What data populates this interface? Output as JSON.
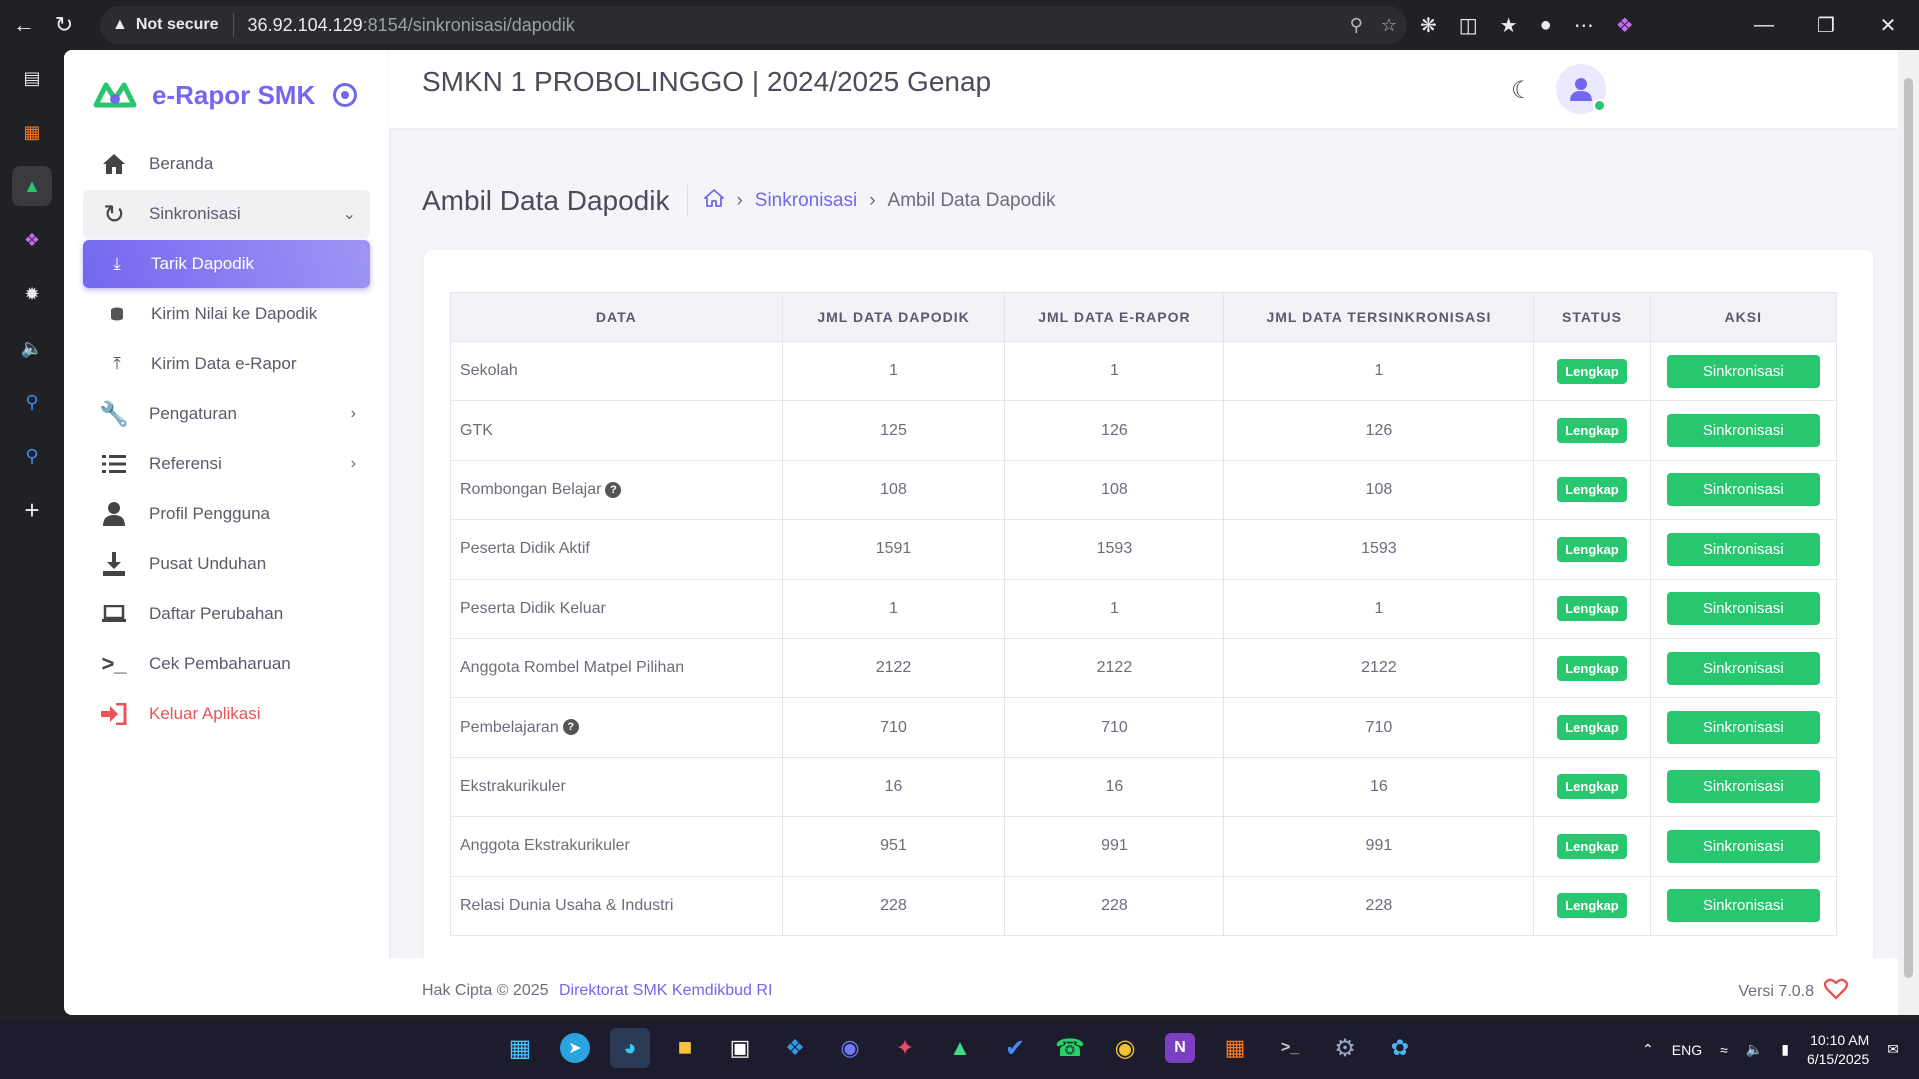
{
  "browser": {
    "security_label": "Not secure",
    "url_host": "36.92.104.129",
    "url_path": ":8154/sinkronisasi/dapodik"
  },
  "app": {
    "brand": "e-Rapor SMK",
    "school_title": "SMKN 1 PROBOLINGGO | 2024/2025 Genap"
  },
  "sidebar": {
    "items": [
      {
        "label": "Beranda",
        "icon": "home-icon"
      },
      {
        "label": "Sinkronisasi",
        "icon": "sync-icon"
      },
      {
        "label": "Pengaturan",
        "icon": "wrench-icon"
      },
      {
        "label": "Referensi",
        "icon": "list-icon"
      },
      {
        "label": "Profil Pengguna",
        "icon": "user-icon"
      },
      {
        "label": "Pusat Unduhan",
        "icon": "download-icon"
      },
      {
        "label": "Daftar Perubahan",
        "icon": "laptop-code-icon"
      },
      {
        "label": "Cek Pembaharuan",
        "icon": "terminal-icon"
      },
      {
        "label": "Keluar Aplikasi",
        "icon": "logout-icon"
      }
    ],
    "sub_items": [
      {
        "label": "Tarik Dapodik",
        "icon": "download-icon"
      },
      {
        "label": "Kirim Nilai ke Dapodik",
        "icon": "database-icon"
      },
      {
        "label": "Kirim Data e-Rapor",
        "icon": "upload-icon"
      }
    ]
  },
  "content": {
    "page_title": "Ambil Data Dapodik",
    "breadcrumb": {
      "parent": "Sinkronisasi",
      "current": "Ambil Data Dapodik"
    },
    "table": {
      "headers": [
        "DATA",
        "JML DATA DAPODIK",
        "JML DATA E-RAPOR",
        "JML DATA TERSINKRONISASI",
        "STATUS",
        "AKSI"
      ],
      "rows": [
        {
          "name": "Sekolah",
          "dapodik": "1",
          "erapor": "1",
          "sync": "1",
          "status": "Lengkap",
          "action": "Sinkronisasi",
          "help": false
        },
        {
          "name": "GTK",
          "dapodik": "125",
          "erapor": "126",
          "sync": "126",
          "status": "Lengkap",
          "action": "Sinkronisasi",
          "help": false
        },
        {
          "name": "Rombongan Belajar",
          "dapodik": "108",
          "erapor": "108",
          "sync": "108",
          "status": "Lengkap",
          "action": "Sinkronisasi",
          "help": true
        },
        {
          "name": "Peserta Didik Aktif",
          "dapodik": "1591",
          "erapor": "1593",
          "sync": "1593",
          "status": "Lengkap",
          "action": "Sinkronisasi",
          "help": false
        },
        {
          "name": "Peserta Didik Keluar",
          "dapodik": "1",
          "erapor": "1",
          "sync": "1",
          "status": "Lengkap",
          "action": "Sinkronisasi",
          "help": false
        },
        {
          "name": "Anggota Rombel Matpel Pilihan",
          "dapodik": "2122",
          "erapor": "2122",
          "sync": "2122",
          "status": "Lengkap",
          "action": "Sinkronisasi",
          "help": false
        },
        {
          "name": "Pembelajaran",
          "dapodik": "710",
          "erapor": "710",
          "sync": "710",
          "status": "Lengkap",
          "action": "Sinkronisasi",
          "help": true
        },
        {
          "name": "Ekstrakurikuler",
          "dapodik": "16",
          "erapor": "16",
          "sync": "16",
          "status": "Lengkap",
          "action": "Sinkronisasi",
          "help": false
        },
        {
          "name": "Anggota Ekstrakurikuler",
          "dapodik": "951",
          "erapor": "991",
          "sync": "991",
          "status": "Lengkap",
          "action": "Sinkronisasi",
          "help": false
        },
        {
          "name": "Relasi Dunia Usaha & Industri",
          "dapodik": "228",
          "erapor": "228",
          "sync": "228",
          "status": "Lengkap",
          "action": "Sinkronisasi",
          "help": false
        }
      ]
    }
  },
  "footer": {
    "copyright": "Hak Cipta © 2025",
    "org_link": "Direktorat SMK Kemdikbud RI",
    "version": "Versi 7.0.8"
  },
  "taskbar": {
    "lang": "ENG",
    "time": "10:10 AM",
    "date": "6/15/2025"
  },
  "colors": {
    "accent": "#7367f0",
    "success": "#28c76f",
    "danger": "#ea5455"
  }
}
